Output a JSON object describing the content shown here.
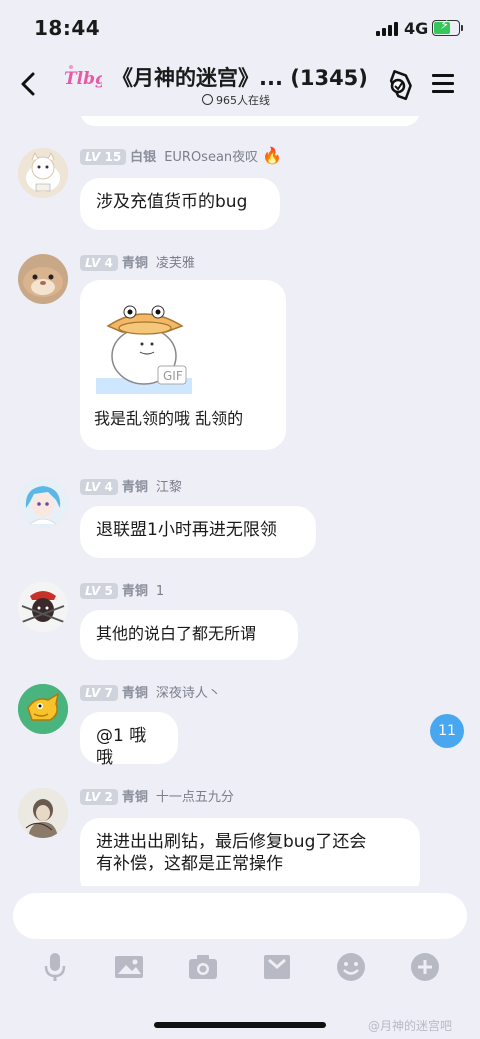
{
  "status": {
    "time": "18:44",
    "network": "4G"
  },
  "nav": {
    "logo_text": "Tlbg",
    "title": "《月神的迷宫》... (1345)",
    "online": "965人在线"
  },
  "messages": [
    {
      "level": "15",
      "rank": "白银",
      "nickname": "EUROsean夜叹",
      "text": "涉及充值货币的bug"
    },
    {
      "level": "4",
      "rank": "青铜",
      "nickname": "凌芙雅",
      "sticker_tag": "GIF",
      "text": "我是乱领的哦 乱领的"
    },
    {
      "level": "4",
      "rank": "青铜",
      "nickname": "江黎",
      "text": "退联盟1小时再进无限领"
    },
    {
      "level": "5",
      "rank": "青铜",
      "nickname": "1",
      "text": "其他的说白了都无所谓"
    },
    {
      "level": "7",
      "rank": "青铜",
      "nickname": "深夜诗人丶",
      "text": "@1 哦哦"
    },
    {
      "level": "2",
      "rank": "青铜",
      "nickname": "十一点五九分",
      "text_line1": "进进出出刷钻，最后修复bug了还会",
      "text_line2": "有补偿，这都是正常操作"
    }
  ],
  "level_prefix": "LV",
  "unread_count": "11",
  "composer": {
    "placeholder": ""
  },
  "toolbar": [
    "mic-icon",
    "image-icon",
    "camera-icon",
    "gift-icon",
    "emoji-icon",
    "plus-icon"
  ],
  "watermark": "@月神的迷宫吧",
  "colors": {
    "background": "#eeeef6",
    "level_badge": "#cfd3dc",
    "unread_badge": "#49a7f0",
    "battery": "#35c759"
  }
}
